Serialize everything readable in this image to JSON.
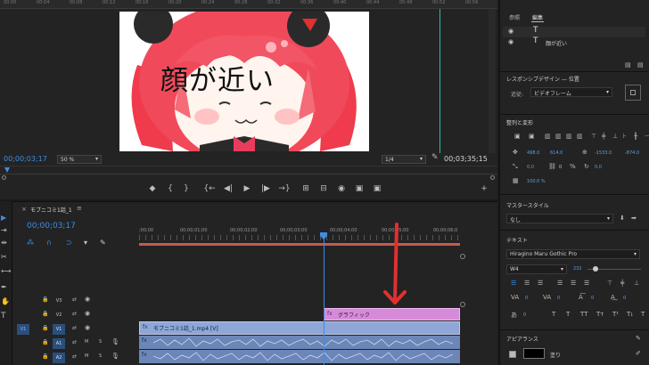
{
  "monitor": {
    "ruler_ticks": [
      "00:00",
      "00:04",
      "00:08",
      "00:12",
      "00:16",
      "00:20",
      "00:24",
      "00:28",
      "00:32",
      "00:36",
      "00:40",
      "00:44",
      "00:48",
      "00:52",
      "00:56"
    ],
    "caption": "顔が近い",
    "timecode_current": "00;00;03;17",
    "zoom": "50 %",
    "resolution": "1/4",
    "timecode_duration": "00;03;35;15"
  },
  "transport": {
    "buttons": [
      "◆",
      "{",
      "}",
      "{←",
      "◀|",
      "▶",
      "|▶",
      "→}",
      "⊞",
      "⊟",
      "◉",
      "▣",
      "▣",
      "+"
    ]
  },
  "essential_graphics": {
    "tabs": [
      "参照",
      "編集"
    ],
    "layers": [
      {
        "icon": "T",
        "label": ""
      },
      {
        "icon": "T",
        "label": "顔が近い"
      }
    ],
    "responsive_label": "レスポンシブデザイン — 位置",
    "follow_label": "追従:",
    "follow_value": "ビデオフレーム",
    "align_transform_label": "整列と変形",
    "pos_x": "498.0",
    "pos_y": "614.0",
    "anchor_x": "-1533.0",
    "anchor_y": "-874.0",
    "rotation": "0.0",
    "scale_pct": "0",
    "opacity_pct": "100.0 %",
    "master_style_label": "マスタースタイル",
    "master_style_value": "なし",
    "text_label": "テキスト",
    "font_value": "Hiragino Maru Gothic Pro",
    "weight_value": "W4",
    "font_size": "232",
    "tracking_vals": [
      "0",
      "0",
      "0",
      "0"
    ],
    "appearance_label": "アピアランス",
    "fill_label": "塗り"
  },
  "timeline": {
    "sequence_tab": "モブニコミ1話_1",
    "timecode": "00;00;03;17",
    "ruler_ticks": [
      ";00;00",
      "00;00;01;00",
      "00;00;02;00",
      "00;00;03;00",
      "00;00;04;00",
      "00;00;05;00",
      "00;00;06;0"
    ],
    "tracks": [
      {
        "name": "V3",
        "kind": "video"
      },
      {
        "name": "V2",
        "kind": "video"
      },
      {
        "name": "V1",
        "kind": "video"
      },
      {
        "name": "A1",
        "kind": "audio",
        "mute": "M",
        "solo": "S"
      },
      {
        "name": "A2",
        "kind": "audio",
        "mute": "M",
        "solo": "S"
      }
    ],
    "clip_graphic": "グラフィック",
    "clip_video": "モブニコミ1話_1.mp4 [V]"
  },
  "colors": {
    "accent": "#3d8ce6",
    "graphic_clip": "#d68bd9",
    "video_clip": "#8fa6d6",
    "audio_clip": "#6c86b8",
    "arrow": "#e03030",
    "teal": "#2fb8b0"
  }
}
